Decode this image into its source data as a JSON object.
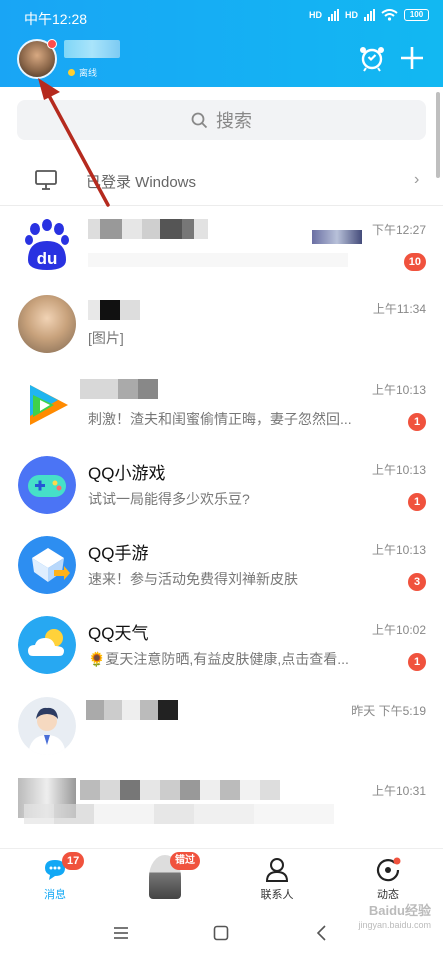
{
  "status_bar": {
    "time": "中午12:28",
    "battery": "100"
  },
  "header": {
    "status_label": "离线"
  },
  "search": {
    "placeholder": "搜索"
  },
  "device": {
    "label": "已登录 Windows"
  },
  "chats": [
    {
      "id": "baidu",
      "name": "",
      "message": "",
      "time": "下午12:27",
      "badge": "10"
    },
    {
      "id": "friend1",
      "name": "",
      "message": "[图片]",
      "time": "上午11:34",
      "badge": ""
    },
    {
      "id": "tencent-video",
      "name": "",
      "message": "刺激！渣夫和闺蜜偷情正晦，妻子忽然回...",
      "time": "上午10:13",
      "badge": "1"
    },
    {
      "id": "qq-minigame",
      "name": "QQ小游戏",
      "message": "试试一局能得多少欢乐豆?",
      "time": "上午10:13",
      "badge": "1"
    },
    {
      "id": "qq-mobile-game",
      "name": "QQ手游",
      "message": "速来！参与活动免费得刘禅新皮肤",
      "time": "上午10:13",
      "badge": "3"
    },
    {
      "id": "qq-weather",
      "name": "QQ天气",
      "message": "🌻夏天注意防晒,有益皮肤健康,点击查看...",
      "time": "上午10:02",
      "badge": "1"
    },
    {
      "id": "friend2",
      "name": "",
      "message": "",
      "time": "昨天 下午5:19",
      "badge": ""
    },
    {
      "id": "friend3",
      "name": "",
      "message": "",
      "time": "上午10:31",
      "badge": ""
    }
  ],
  "tabs": [
    {
      "label": "消息",
      "badge": "17",
      "active": true
    },
    {
      "label": "",
      "badge": "错过",
      "active": false
    },
    {
      "label": "联系人",
      "badge": "",
      "active": false
    },
    {
      "label": "动态",
      "badge": "",
      "active": false
    }
  ],
  "watermark": {
    "title": "Baidu经验",
    "url": "jingyan.baidu.com"
  },
  "colors": {
    "header": "#19a5f5",
    "badge": "#f0523d",
    "tab_active": "#12a8f5",
    "arrow": "#b52a1e"
  },
  "icons": {
    "header": [
      "alarm-icon",
      "plus-icon"
    ],
    "chat_avatars": [
      "baidu-paw-icon",
      "photo-avatar",
      "tencent-video-icon",
      "game-controller-icon",
      "qq-game-icon",
      "weather-cloud-icon",
      "person-avatar",
      "blurred-avatar"
    ],
    "tabs": [
      "message-icon",
      "avatar",
      "contacts-icon",
      "moments-icon"
    ],
    "nav": [
      "menu-icon",
      "home-icon",
      "back-icon"
    ]
  }
}
